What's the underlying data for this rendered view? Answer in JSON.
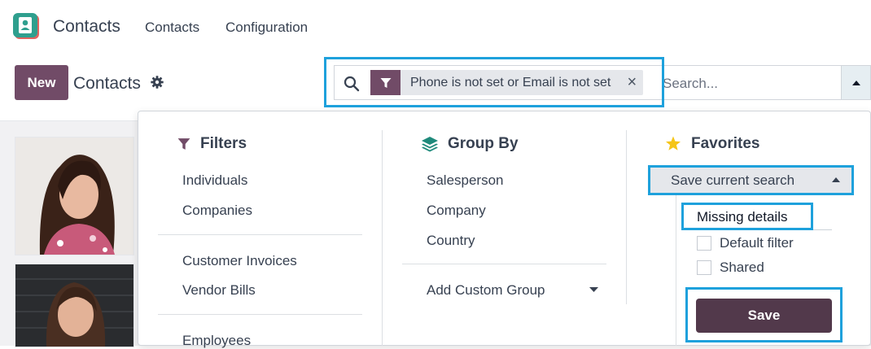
{
  "topbar": {
    "app_title": "Contacts",
    "nav": [
      "Contacts",
      "Configuration"
    ]
  },
  "controlbar": {
    "new_label": "New",
    "title": "Contacts"
  },
  "search": {
    "facet_label": "Phone is not set or Email is not set",
    "facet_close": "×",
    "placeholder": "Search..."
  },
  "filters": {
    "title": "Filters",
    "group1": [
      "Individuals",
      "Companies"
    ],
    "group2": [
      "Customer Invoices",
      "Vendor Bills"
    ],
    "group3": [
      "Employees"
    ]
  },
  "group_by": {
    "title": "Group By",
    "items": [
      "Salesperson",
      "Company",
      "Country"
    ],
    "custom": "Add Custom Group"
  },
  "favorites": {
    "title": "Favorites",
    "save_current": "Save current search",
    "name_value": "Missing details",
    "options": [
      "Default filter",
      "Shared"
    ],
    "save_label": "Save"
  },
  "colors": {
    "brand": "#714B67",
    "save_button": "#52394B",
    "highlight": "#1EA1DC",
    "star": "#F5C518",
    "stack": "#1F8A7B"
  },
  "icons": [
    "contacts-app-icon",
    "gear-icon",
    "search-icon",
    "filter-icon",
    "close-icon",
    "caret-up-icon",
    "layers-icon",
    "star-icon",
    "caret-down-icon"
  ]
}
